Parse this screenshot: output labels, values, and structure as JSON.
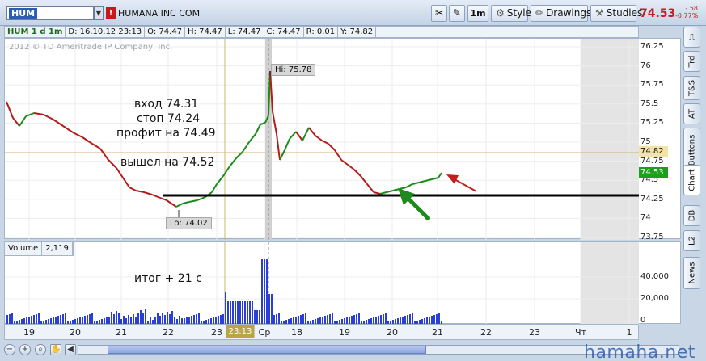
{
  "toolbar": {
    "symbol": "HUM",
    "company": "HUMANA INC COM",
    "interval": "1m",
    "style_label": "Style",
    "drawings_label": "Drawings",
    "studies_label": "Studies",
    "last_price": "74.53",
    "change": "-.58",
    "change_pct": "-0.77%"
  },
  "infobar": {
    "title": "HUM 1 d 1m",
    "date": "D: 16.10.12 23:13",
    "open": "O: 74.47",
    "high": "H: 74.47",
    "low": "L: 74.47",
    "close": "C: 74.47",
    "range": "R: 0.01",
    "y": "Y: 74.82"
  },
  "copyright": "2012 © TD Ameritrade IP Company, Inc.",
  "price_axis": {
    "ticks": [
      "76.25",
      "76",
      "75.75",
      "75.5",
      "75.25",
      "75",
      "74.75",
      "74.5",
      "74.25",
      "74",
      "73.75"
    ],
    "cursor_flag": "74.82",
    "last_flag": "74.53",
    "cursor_color": "#f2e3a8",
    "last_color": "#1aa11a"
  },
  "volume": {
    "label": "Volume",
    "value": "2,119",
    "ticks": [
      "40,000",
      "20,000",
      "0"
    ]
  },
  "annotations": {
    "entry": "вход 74.31",
    "stop": "стоп 74.24",
    "profit": "профит на 74.49",
    "exit": "вышел на 74.52",
    "result": "итог + 21 с",
    "hi_label": "Hi: 75.78",
    "lo_label": "Lo: 74.02"
  },
  "xaxis": {
    "ticks": [
      "19",
      "20",
      "21",
      "22",
      "23",
      "Ср",
      "18",
      "19",
      "20",
      "21",
      "22",
      "23",
      "Чт",
      "1"
    ],
    "cursor_time": "23:13"
  },
  "sidebar_tabs": [
    "Trd",
    "T&S",
    "AT",
    "Buttons",
    "Chart",
    "DB",
    "L2",
    "News"
  ],
  "watermark": "hamaha.net",
  "colors": {
    "up": "#1a8c1a",
    "down": "#b31b1b",
    "arrow_green": "#1e8a1e",
    "arrow_red": "#c21e1e",
    "accent": "#2b5cb6"
  }
}
